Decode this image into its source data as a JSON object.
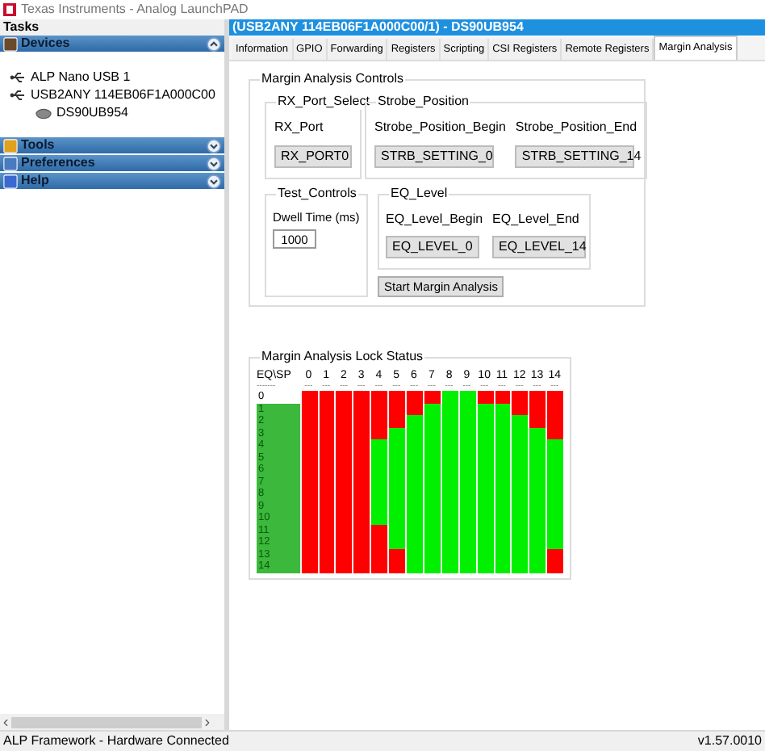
{
  "window": {
    "title": "Texas Instruments - Analog LaunchPAD"
  },
  "sidebar": {
    "title": "Tasks",
    "sections": [
      {
        "label": "Devices",
        "expanded": true,
        "tree": [
          {
            "label": "ALP Nano USB 1",
            "kind": "usb"
          },
          {
            "label": "USB2ANY 114EB06F1A000C00",
            "kind": "usb",
            "children": [
              {
                "label": "DS90UB954",
                "kind": "chip"
              }
            ]
          }
        ]
      },
      {
        "label": "Tools",
        "expanded": false
      },
      {
        "label": "Preferences",
        "expanded": false
      },
      {
        "label": "Help",
        "expanded": false
      }
    ]
  },
  "device_panel": {
    "title": "(USB2ANY 114EB06F1A000C00/1) - DS90UB954",
    "tabs": [
      {
        "label": "Information",
        "selected": false
      },
      {
        "label": "GPIO",
        "selected": false
      },
      {
        "label": "Forwarding",
        "selected": false
      },
      {
        "label": "Registers",
        "selected": false
      },
      {
        "label": "Scripting",
        "selected": false
      },
      {
        "label": "CSI Registers",
        "selected": false
      },
      {
        "label": "Remote Registers",
        "selected": false
      },
      {
        "label": "Margin Analysis",
        "selected": true
      }
    ],
    "controls": {
      "title": "Margin Analysis Controls",
      "rx_port_select": {
        "title": "RX_Port_Select",
        "label": "RX_Port",
        "value": "RX_PORT0"
      },
      "strobe_position": {
        "title": "Strobe_Position",
        "begin_label": "Strobe_Position_Begin",
        "begin_value": "STRB_SETTING_0",
        "end_label": "Strobe_Position_End",
        "end_value": "STRB_SETTING_14"
      },
      "test_controls": {
        "title": "Test_Controls",
        "label": "Dwell Time (ms)",
        "value": "1000"
      },
      "eq_level": {
        "title": "EQ_Level",
        "begin_label": "EQ_Level_Begin",
        "begin_value": "EQ_LEVEL_0",
        "end_label": "EQ_Level_End",
        "end_value": "EQ_LEVEL_14"
      },
      "start_button": "Start Margin Analysis"
    },
    "lock_status": {
      "title": "Margin Analysis Lock Status",
      "corner": {
        "label": "EQ\\SP",
        "rule": "-------"
      },
      "columns": [
        {
          "label": "0",
          "rule": "---"
        },
        {
          "label": "1",
          "rule": "---"
        },
        {
          "label": "2",
          "rule": "---"
        },
        {
          "label": "3",
          "rule": "---"
        },
        {
          "label": "4",
          "rule": "---"
        },
        {
          "label": "5",
          "rule": "---"
        },
        {
          "label": "6",
          "rule": "---"
        },
        {
          "label": "7",
          "rule": "---"
        },
        {
          "label": "8",
          "rule": "---"
        },
        {
          "label": "9",
          "rule": "---"
        },
        {
          "label": "10",
          "rule": "---"
        },
        {
          "label": "11",
          "rule": "---"
        },
        {
          "label": "12",
          "rule": "---"
        },
        {
          "label": "13",
          "rule": "---"
        },
        {
          "label": "14",
          "rule": "---"
        }
      ],
      "rows": [
        {
          "label": "0",
          "highlighted": false,
          "locked": [
            false,
            false,
            false,
            false,
            false,
            false,
            false,
            false,
            true,
            true,
            false,
            false,
            false,
            false,
            false
          ]
        },
        {
          "label": "1",
          "highlighted": true,
          "locked": [
            false,
            false,
            false,
            false,
            false,
            false,
            false,
            true,
            true,
            true,
            true,
            true,
            false,
            false,
            false
          ]
        },
        {
          "label": "2",
          "highlighted": true,
          "locked": [
            false,
            false,
            false,
            false,
            false,
            false,
            true,
            true,
            true,
            true,
            true,
            true,
            true,
            false,
            false
          ]
        },
        {
          "label": "3",
          "highlighted": true,
          "locked": [
            false,
            false,
            false,
            false,
            false,
            true,
            true,
            true,
            true,
            true,
            true,
            true,
            true,
            true,
            false
          ]
        },
        {
          "label": "4",
          "highlighted": true,
          "locked": [
            false,
            false,
            false,
            false,
            true,
            true,
            true,
            true,
            true,
            true,
            true,
            true,
            true,
            true,
            true
          ]
        },
        {
          "label": "5",
          "highlighted": true,
          "locked": [
            false,
            false,
            false,
            false,
            true,
            true,
            true,
            true,
            true,
            true,
            true,
            true,
            true,
            true,
            true
          ]
        },
        {
          "label": "6",
          "highlighted": true,
          "locked": [
            false,
            false,
            false,
            false,
            true,
            true,
            true,
            true,
            true,
            true,
            true,
            true,
            true,
            true,
            true
          ]
        },
        {
          "label": "7",
          "highlighted": true,
          "locked": [
            false,
            false,
            false,
            false,
            true,
            true,
            true,
            true,
            true,
            true,
            true,
            true,
            true,
            true,
            true
          ]
        },
        {
          "label": "8",
          "highlighted": true,
          "locked": [
            false,
            false,
            false,
            false,
            true,
            true,
            true,
            true,
            true,
            true,
            true,
            true,
            true,
            true,
            true
          ]
        },
        {
          "label": "9",
          "highlighted": true,
          "locked": [
            false,
            false,
            false,
            false,
            true,
            true,
            true,
            true,
            true,
            true,
            true,
            true,
            true,
            true,
            true
          ]
        },
        {
          "label": "10",
          "highlighted": true,
          "locked": [
            false,
            false,
            false,
            false,
            true,
            true,
            true,
            true,
            true,
            true,
            true,
            true,
            true,
            true,
            true
          ]
        },
        {
          "label": "11",
          "highlighted": true,
          "locked": [
            false,
            false,
            false,
            false,
            false,
            true,
            true,
            true,
            true,
            true,
            true,
            true,
            true,
            true,
            true
          ]
        },
        {
          "label": "12",
          "highlighted": true,
          "locked": [
            false,
            false,
            false,
            false,
            false,
            true,
            true,
            true,
            true,
            true,
            true,
            true,
            true,
            true,
            true
          ]
        },
        {
          "label": "13",
          "highlighted": true,
          "locked": [
            false,
            false,
            false,
            false,
            false,
            false,
            true,
            true,
            true,
            true,
            true,
            true,
            true,
            true,
            false
          ]
        },
        {
          "label": "14",
          "highlighted": true,
          "locked": [
            false,
            false,
            false,
            false,
            false,
            false,
            true,
            true,
            true,
            true,
            true,
            true,
            true,
            true,
            false
          ]
        }
      ]
    }
  },
  "status_bar": {
    "left": "ALP Framework - Hardware Connected",
    "right": "v1.57.0010"
  }
}
